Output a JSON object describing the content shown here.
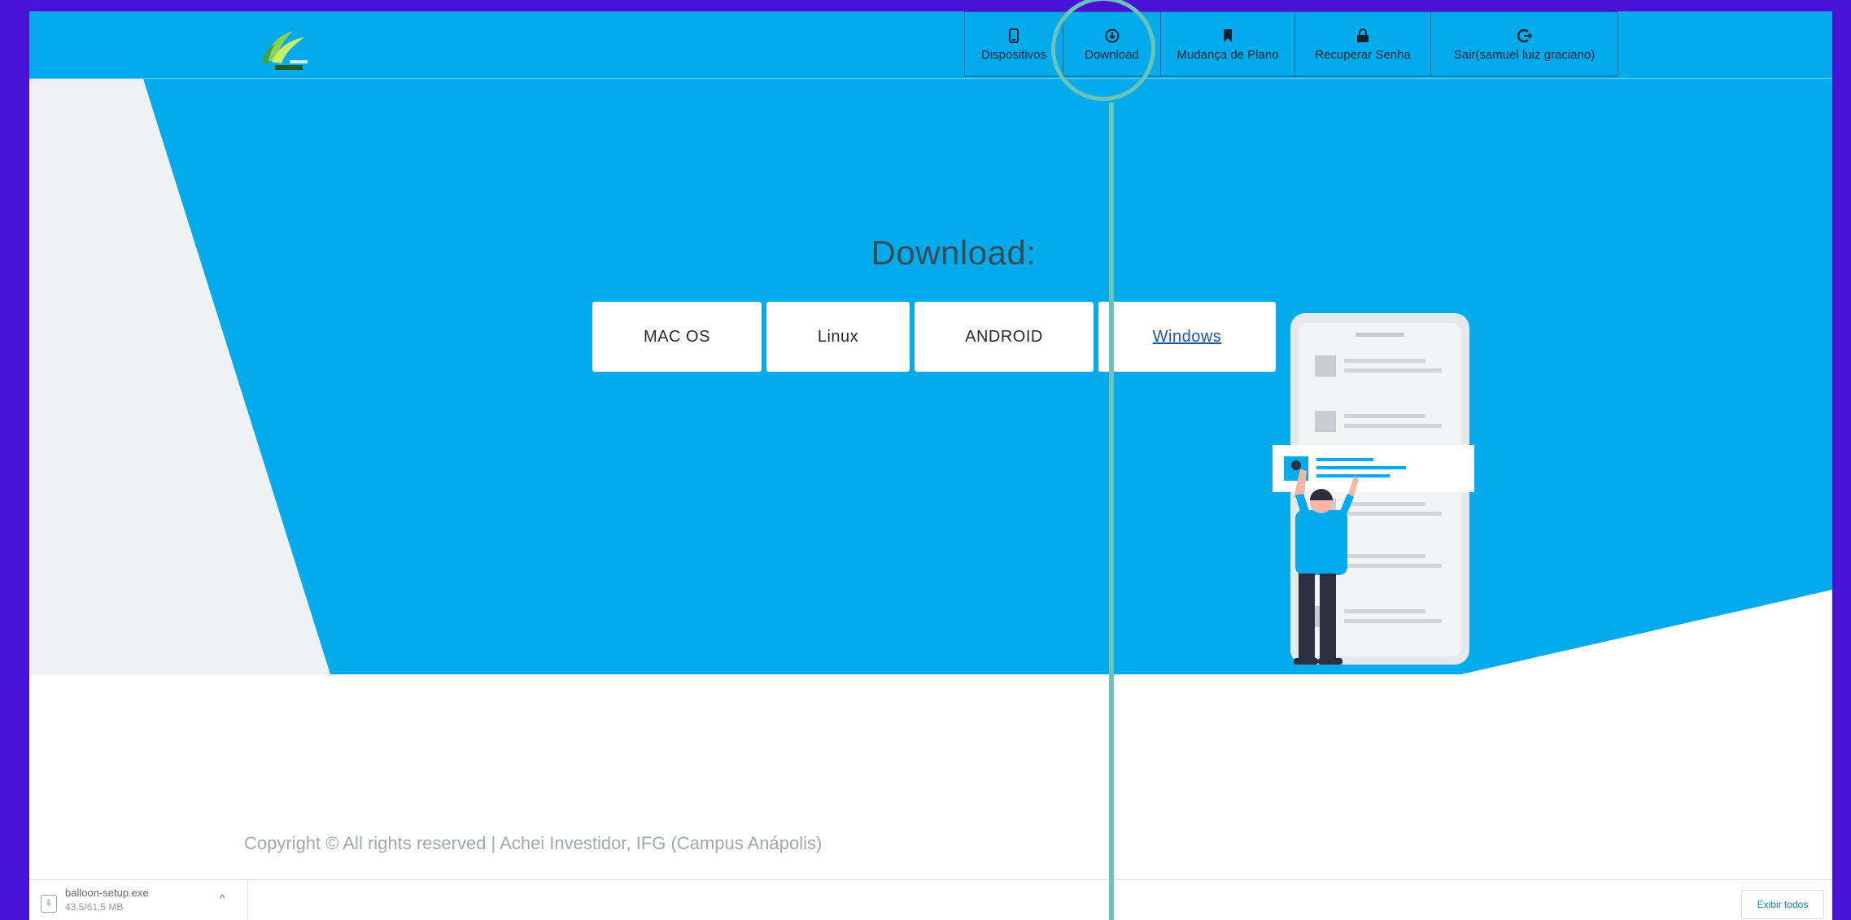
{
  "colors": {
    "frame_bg": "#4a12d6",
    "brand_blue": "#02acec",
    "callout": "#6cc3b5"
  },
  "nav": {
    "items": [
      {
        "label": "Dispositivos",
        "icon": "phone-icon"
      },
      {
        "label": "Download",
        "icon": "download-circle-icon"
      },
      {
        "label": "Mudança de Plano",
        "icon": "bookmark-icon"
      },
      {
        "label": "Recuperar Senha",
        "icon": "lock-icon"
      },
      {
        "label": "Sair(samuel luiz graciano)",
        "icon": "logout-icon"
      }
    ]
  },
  "main": {
    "title": "Download:",
    "buttons": [
      "MAC OS",
      "Linux",
      "ANDROID",
      "Windows"
    ]
  },
  "footer": {
    "copyright": "Copyright © All rights reserved | Achei Investidor, IFG (Campus Anápolis)"
  },
  "download_bar": {
    "file_name": "balloon-setup.exe",
    "file_status": "43,5/61,5 MB",
    "show_all": "Exibir todos"
  }
}
